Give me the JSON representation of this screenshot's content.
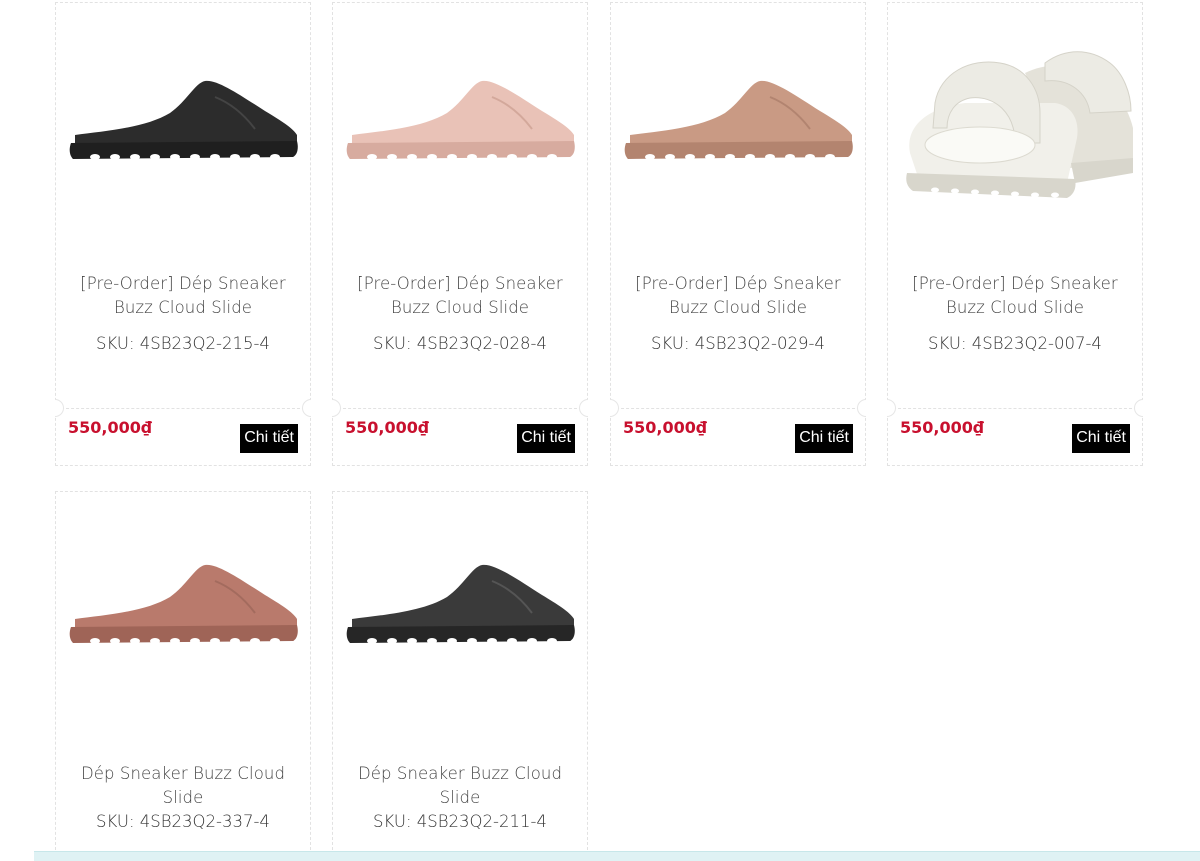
{
  "products": [
    {
      "name": "[Pre-Order] Dép Sneaker Buzz Cloud Slide",
      "sku": "SKU: 4SB23Q2-215-4",
      "price": "550,000₫",
      "detail_label": "Chi tiết",
      "color": "#2c2c2c",
      "sole_color": "#1f1f1f",
      "icon": "black-slide-image"
    },
    {
      "name": "[Pre-Order] Dép Sneaker Buzz Cloud Slide",
      "sku": "SKU: 4SB23Q2-028-4",
      "price": "550,000₫",
      "detail_label": "Chi tiết",
      "color": "#e9c2b7",
      "sole_color": "#d7ab9f",
      "icon": "pink-slide-image"
    },
    {
      "name": "[Pre-Order] Dép Sneaker Buzz Cloud Slide",
      "sku": "SKU: 4SB23Q2-029-4",
      "price": "550,000₫",
      "detail_label": "Chi tiết",
      "color": "#c99a84",
      "sole_color": "#b3846f",
      "icon": "tan-slide-image"
    },
    {
      "name": "[Pre-Order] Dép Sneaker Buzz Cloud Slide",
      "sku": "SKU: 4SB23Q2-007-4",
      "price": "550,000₫",
      "detail_label": "Chi tiết",
      "color": "#ecebe4",
      "sole_color": "#d8d6cc",
      "icon": "cream-slide-pair-image"
    },
    {
      "name": "Dép Sneaker Buzz Cloud Slide",
      "sku": "SKU: 4SB23Q2-337-4",
      "color": "#b97a6c",
      "sole_color": "#9f6457",
      "icon": "terracotta-slide-image"
    },
    {
      "name": "Dép Sneaker Buzz Cloud Slide",
      "sku": "SKU: 4SB23Q2-211-4",
      "color": "#3a3a3a",
      "sole_color": "#262626",
      "icon": "dark-grey-slide-image"
    }
  ]
}
